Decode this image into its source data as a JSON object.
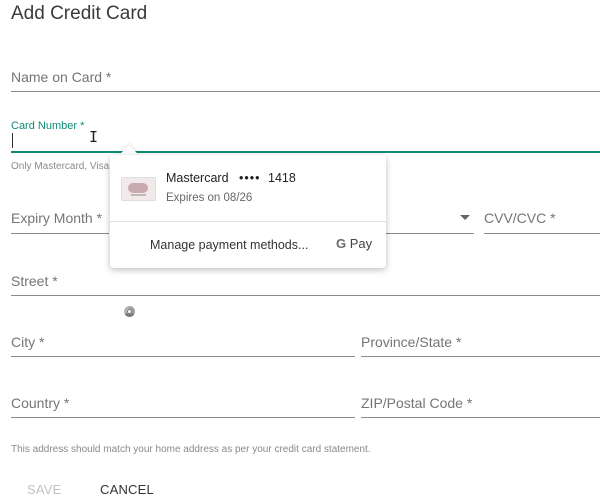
{
  "page": {
    "title": "Add Credit Card"
  },
  "form": {
    "name_label": "Name on Card *",
    "card_number_label": "Card Number *",
    "card_hint": "Only Mastercard, Visa",
    "expiry_month_label": "Expiry Month *",
    "cvv_label": "CVV/CVC *",
    "street_label": "Street *",
    "city_label": "City *",
    "province_label": "Province/State *",
    "country_label": "Country *",
    "zip_label": "ZIP/Postal Code *",
    "address_note": "This address should match your home address as per your credit card statement."
  },
  "autofill": {
    "card_brand": "Mastercard",
    "card_mask": "••••",
    "card_last4": "1418",
    "expires": "Expires on 08/26",
    "manage_label": "Manage payment methods...",
    "gpay_label": "Pay"
  },
  "actions": {
    "save_label": "SAVE",
    "cancel_label": "CANCEL"
  },
  "colors": {
    "accent": "#0f8a76",
    "disabled": "#c2c2c2"
  }
}
